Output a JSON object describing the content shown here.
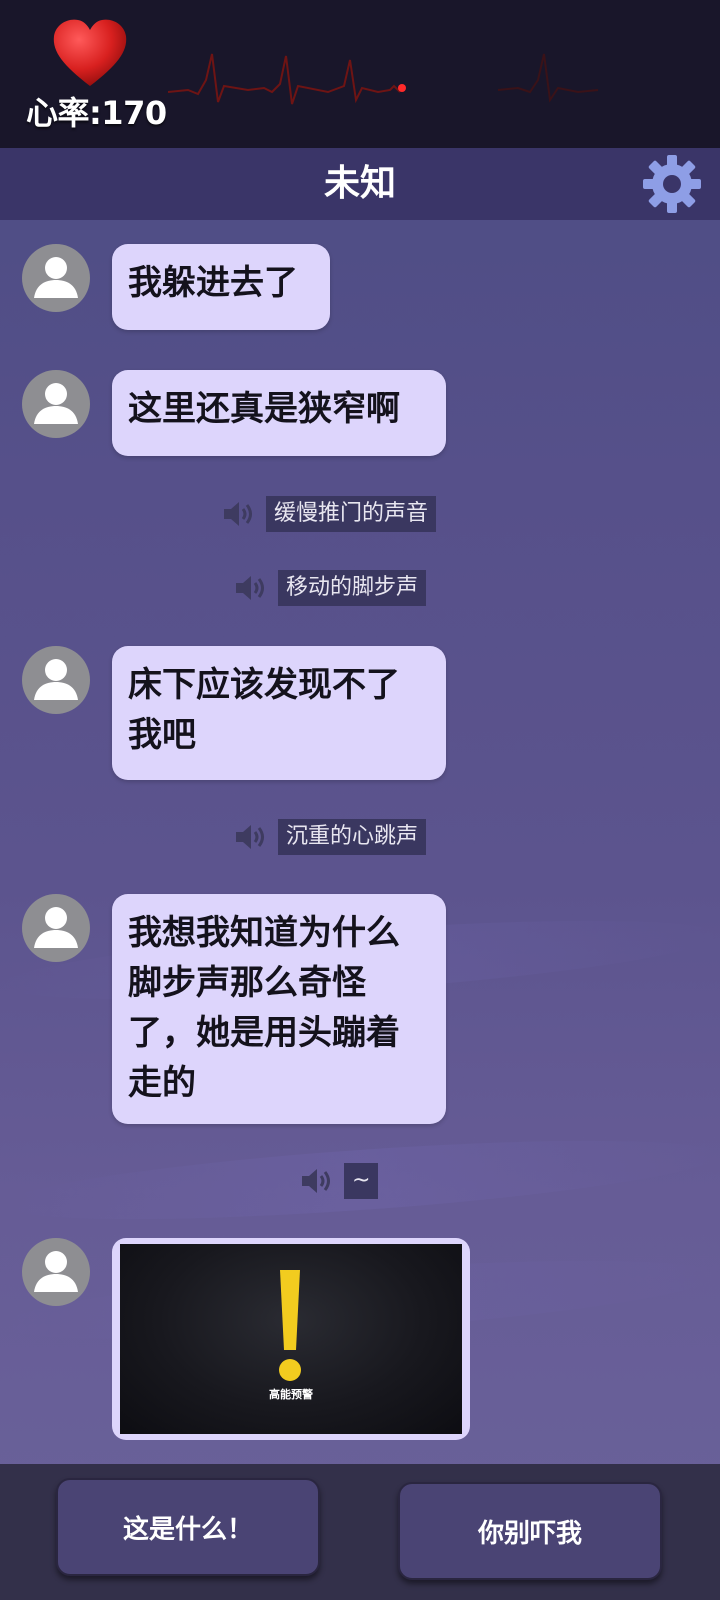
{
  "heart_rate": {
    "label": "心率:170",
    "icon": "heart-icon",
    "color": "#e02a2a"
  },
  "header": {
    "title": "未知",
    "settings_icon": "gear-icon"
  },
  "messages": [
    {
      "type": "text",
      "text": "我躲进去了"
    },
    {
      "type": "text",
      "text": "这里还真是狭窄啊"
    },
    {
      "type": "sound",
      "text": "缓慢推门的声音"
    },
    {
      "type": "sound",
      "text": "移动的脚步声"
    },
    {
      "type": "text",
      "text": "床下应该发现不了我吧"
    },
    {
      "type": "sound",
      "text": "沉重的心跳声"
    },
    {
      "type": "text",
      "text": "我想我知道为什么脚步声那么奇怪了，她是用头蹦着走的"
    },
    {
      "type": "sound",
      "text": "~"
    },
    {
      "type": "image",
      "caption": "高能预警"
    }
  ],
  "choices": [
    {
      "label": "这是什么！"
    },
    {
      "label": "你别吓我"
    }
  ],
  "colors": {
    "bubble": "#ddd5fc",
    "title_bar": "#3a3568",
    "warning_yellow": "#f2cc1f"
  }
}
